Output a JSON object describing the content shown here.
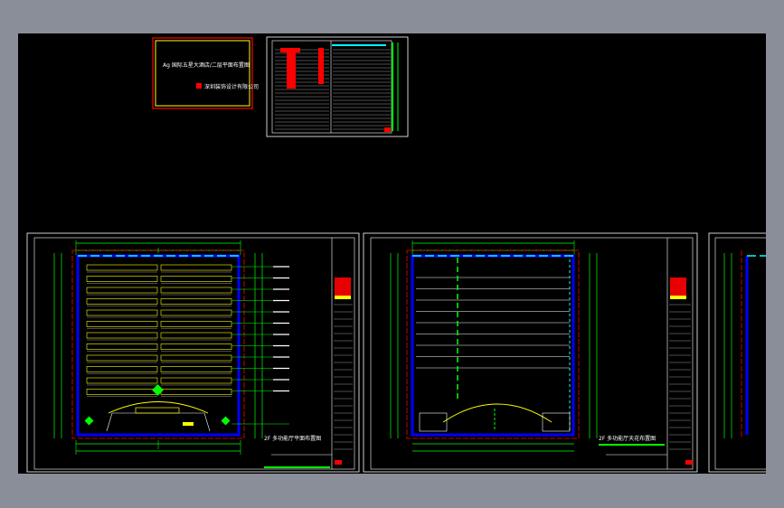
{
  "cover": {
    "project_title": "Ag 国际五星大酒店/二层平面布置图",
    "company_name": "深圳装饰设计有限公司"
  },
  "sheets": [
    {
      "plan_title": "2F 多功能厅平面布置图"
    },
    {
      "plan_title": "2F 多功能厅天花布置图"
    }
  ],
  "colors": {
    "background": "#000000",
    "frame": "#ffffff",
    "wall": "#0000ff",
    "dimension": "#00ff00",
    "red_line": "#ff0000",
    "cyan": "#00ffff",
    "yellow": "#ffff00"
  }
}
